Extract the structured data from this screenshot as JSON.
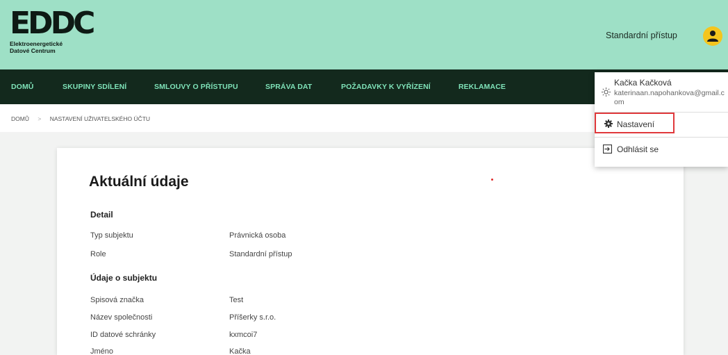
{
  "header": {
    "logo_mark": "EDDC",
    "logo_line1": "Elektroenergetické",
    "logo_line2": "Datové Centrum",
    "access_label": "Standardní přístup",
    "avatar_icon": "user-icon"
  },
  "nav": {
    "items": [
      "DOMŮ",
      "SKUPINY SDÍLENÍ",
      "SMLOUVY O PŘÍSTUPU",
      "SPRÁVA DAT",
      "POŽADAVKY K VYŘÍZENÍ",
      "REKLAMACE"
    ]
  },
  "breadcrumb": {
    "home": "DOMŮ",
    "separator": ">",
    "current": "NASTAVENÍ UŽIVATELSKÉHO ÚČTU"
  },
  "card": {
    "title": "Aktuální údaje",
    "sections": [
      {
        "heading": "Detail",
        "rows": [
          {
            "label": "Typ subjektu",
            "value": "Právnická osoba"
          },
          {
            "label": "Role",
            "value": "Standardní přístup"
          }
        ]
      },
      {
        "heading": "Údaje o subjektu",
        "rows": [
          {
            "label": "Spisová značka",
            "value": "Test"
          },
          {
            "label": "Název společnosti",
            "value": "Příšerky s.r.o."
          },
          {
            "label": "ID datové schránky",
            "value": "kxmcoi7"
          },
          {
            "label": "Jméno",
            "value": "Kačka"
          }
        ]
      }
    ]
  },
  "user_menu": {
    "name": "Kačka Kačková",
    "email": "katerinaan.napohankova@gmail.com",
    "settings_label": "Nastavení",
    "logout_label": "Odhlásit se"
  },
  "colors": {
    "header_bg": "#9ee0c6",
    "nav_bg": "#13291d",
    "nav_text": "#7fe3b9",
    "avatar": "#f4c51e",
    "highlight_border": "#e0383b"
  }
}
